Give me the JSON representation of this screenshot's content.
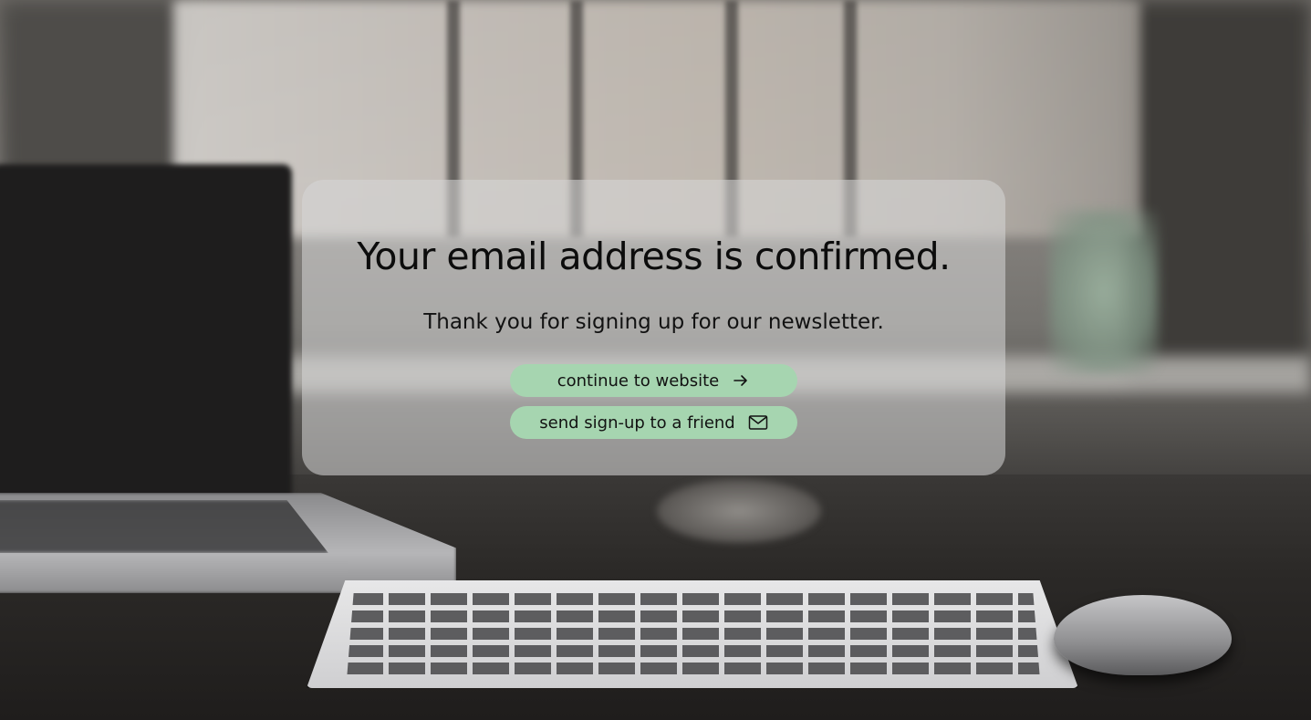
{
  "confirmation": {
    "title": "Your email address is confirmed.",
    "subtitle": "Thank you for signing up for our newsletter."
  },
  "actions": {
    "continue_label": "continue to website",
    "continue_icon": "arrow-right-icon",
    "share_label": "send sign-up to a friend",
    "share_icon": "envelope-icon"
  },
  "colors": {
    "button_bg": "#a6d5b0",
    "card_bg": "rgba(215,215,215,0.55)",
    "text": "#121212"
  }
}
